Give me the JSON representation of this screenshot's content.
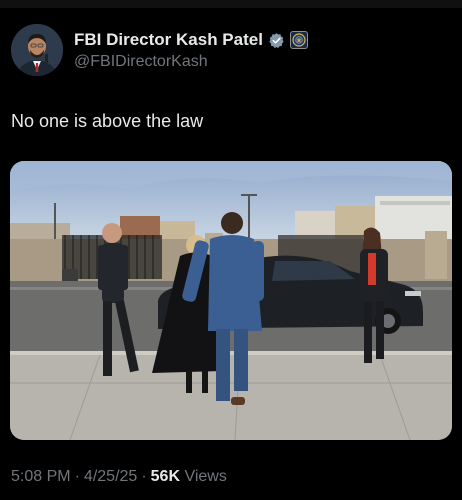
{
  "author": {
    "display_name": "FBI Director Kash Patel",
    "handle": "@FBIDirectorKash",
    "verified_icon": "verified-badge-icon",
    "affiliate_icon": "fbi-seal-icon"
  },
  "tweet": {
    "text": "No one is above the law"
  },
  "meta": {
    "time": "5:08 PM",
    "separator": "·",
    "date": "4/25/25",
    "views_count": "56K",
    "views_label": "Views"
  },
  "colors": {
    "background": "#000000",
    "primary_text": "#e7e9ea",
    "secondary_text": "#71767b",
    "verified_badge": "#829aab"
  }
}
